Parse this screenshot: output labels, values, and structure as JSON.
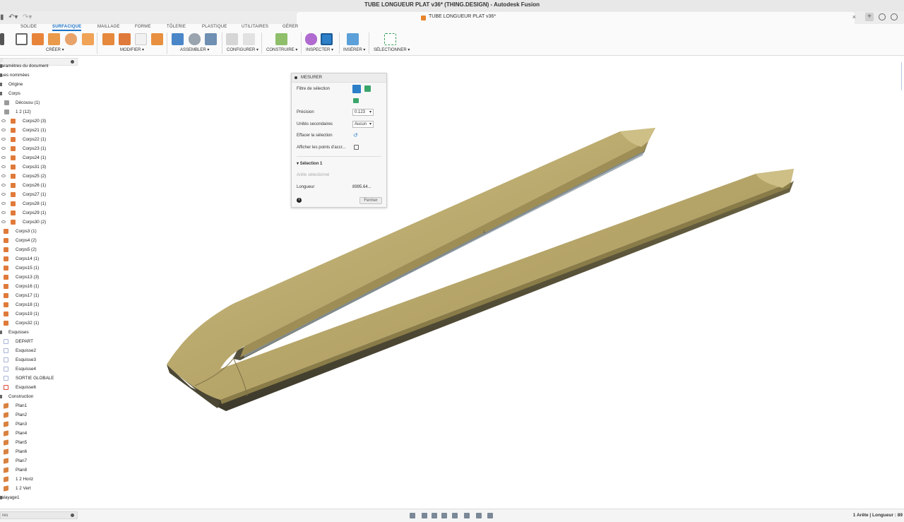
{
  "window": {
    "title": "TUBE LONGUEUR PLAT v36* (THING.DESIGN) - Autodesk Fusion"
  },
  "doc_tab": {
    "label": "TUBE LONGUEUR PLAT v36*",
    "close": "×"
  },
  "new_tab": "+",
  "ribbon": {
    "workspace_tabs": [
      "SOLIDE",
      "SURFACIQUE",
      "MAILLAGE",
      "FORME",
      "TÔLERIE",
      "PLASTIQUE",
      "UTILITAIRES",
      "GÉRER"
    ],
    "active_tab": "SURFACIQUE",
    "groups": [
      "CRÉER ▾",
      "MODIFIER ▾",
      "ASSEMBLER ▾",
      "CONFIGURER ▾",
      "CONSTRUIRE ▾",
      "INSPECTER ▾",
      "INSÉRER ▾",
      "SÉLECTIONNER ▾"
    ]
  },
  "browser": {
    "search_value": ":",
    "items": [
      {
        "label": "aramètres du document",
        "icon": "none",
        "eye": false
      },
      {
        "label": "ues nommées",
        "icon": "none",
        "eye": false
      },
      {
        "label": "Origine",
        "icon": "none",
        "eye": false
      },
      {
        "label": "Corps",
        "icon": "none",
        "eye": false
      },
      {
        "label": "Décousu (1)",
        "icon": "folder",
        "eye": false
      },
      {
        "label": "1 2 (12)",
        "icon": "folder",
        "eye": false
      },
      {
        "label": "Corps20 (3)",
        "icon": "body",
        "eye": true
      },
      {
        "label": "Corps21 (1)",
        "icon": "body",
        "eye": true
      },
      {
        "label": "Corps22 (1)",
        "icon": "body",
        "eye": true
      },
      {
        "label": "Corps23 (1)",
        "icon": "body",
        "eye": true
      },
      {
        "label": "Corps24 (1)",
        "icon": "body",
        "eye": true
      },
      {
        "label": "Corps31 (3)",
        "icon": "body",
        "eye": true
      },
      {
        "label": "Corps25 (2)",
        "icon": "body",
        "eye": true
      },
      {
        "label": "Corps26 (1)",
        "icon": "body",
        "eye": true
      },
      {
        "label": "Corps27 (1)",
        "icon": "body",
        "eye": true
      },
      {
        "label": "Corps28 (1)",
        "icon": "body",
        "eye": true
      },
      {
        "label": "Corps29 (1)",
        "icon": "body",
        "eye": true
      },
      {
        "label": "Corps30 (2)",
        "icon": "body",
        "eye": true
      },
      {
        "label": "Corps3 (1)",
        "icon": "body",
        "eye": false
      },
      {
        "label": "Corps4 (2)",
        "icon": "body",
        "eye": false
      },
      {
        "label": "Corps5 (2)",
        "icon": "body",
        "eye": false
      },
      {
        "label": "Corps14 (1)",
        "icon": "body",
        "eye": false
      },
      {
        "label": "Corps15 (1)",
        "icon": "body",
        "eye": false
      },
      {
        "label": "Corps13 (3)",
        "icon": "body",
        "eye": false
      },
      {
        "label": "Corps16 (1)",
        "icon": "body",
        "eye": false
      },
      {
        "label": "Corps17 (1)",
        "icon": "body",
        "eye": false
      },
      {
        "label": "Corps18 (1)",
        "icon": "body",
        "eye": false
      },
      {
        "label": "Corps19 (1)",
        "icon": "body",
        "eye": false
      },
      {
        "label": "Corps32 (1)",
        "icon": "body",
        "eye": false
      },
      {
        "label": "Esquisses",
        "icon": "none",
        "eye": false
      },
      {
        "label": "DEPART",
        "icon": "sketch",
        "eye": false
      },
      {
        "label": "Esquisse2",
        "icon": "sketch",
        "eye": false
      },
      {
        "label": "Esquisse3",
        "icon": "sketch",
        "eye": false
      },
      {
        "label": "Esquisse4",
        "icon": "sketch",
        "eye": false
      },
      {
        "label": "SORTIE GLOBALE",
        "icon": "sketch",
        "eye": false
      },
      {
        "label": "Esquisse6",
        "icon": "sketchr",
        "eye": false
      },
      {
        "label": "Construction",
        "icon": "none",
        "eye": false
      },
      {
        "label": "Plan1",
        "icon": "plane",
        "eye": false
      },
      {
        "label": "Plan2",
        "icon": "plane",
        "eye": false
      },
      {
        "label": "Plan3",
        "icon": "plane",
        "eye": false
      },
      {
        "label": "Plan4",
        "icon": "plane",
        "eye": false
      },
      {
        "label": "Plan5",
        "icon": "plane",
        "eye": false
      },
      {
        "label": "Plan6",
        "icon": "plane",
        "eye": false
      },
      {
        "label": "Plan7",
        "icon": "plane",
        "eye": false
      },
      {
        "label": "Plan8",
        "icon": "plane",
        "eye": false
      },
      {
        "label": "1 2 Horiz",
        "icon": "plane",
        "eye": false
      },
      {
        "label": "1 2 Vert",
        "icon": "plane",
        "eye": false
      },
      {
        "label": "alayage1",
        "icon": "none",
        "eye": false
      }
    ]
  },
  "measure": {
    "title": "MESURER",
    "selection_filter": "Filtre de sélection",
    "precision_label": "Précision",
    "precision_value": "0.123",
    "secondary_label": "Unités secondaires",
    "secondary_value": "Aucun",
    "clear_label": "Effacer la sélection",
    "snap_label": "Afficher les points d'accr...",
    "section": "Sélection 1",
    "selected_label": "Arête sélectionné",
    "length_label": "Longueur",
    "length_value": "8995.64...",
    "close_label": "Fermer",
    "info": "i"
  },
  "viewport": {
    "marker": "1"
  },
  "bottom": {
    "field": "res"
  },
  "status": {
    "text": "1 Arête | Longueur : 89"
  }
}
